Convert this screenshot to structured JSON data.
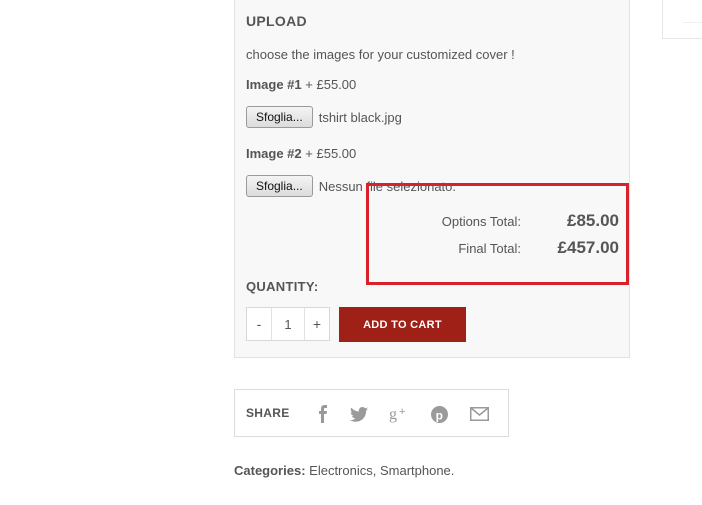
{
  "upload": {
    "title": "UPLOAD",
    "description": "choose the images for your customized cover !",
    "images": [
      {
        "label": "Image #1",
        "price": "+ £55.00",
        "button": "Sfoglia...",
        "file": "tshirt black.jpg"
      },
      {
        "label": "Image #2",
        "price": "+ £55.00",
        "button": "Sfoglia...",
        "file": "Nessun file selezionato."
      }
    ]
  },
  "totals": {
    "options_label": "Options Total:",
    "options_value": "£85.00",
    "final_label": "Final Total:",
    "final_value": "£457.00"
  },
  "quantity": {
    "label": "QUANTITY:",
    "minus": "-",
    "value": "1",
    "plus": "+",
    "add_to_cart": "ADD TO CART"
  },
  "share": {
    "label": "SHARE",
    "icons": [
      "facebook-icon",
      "twitter-icon",
      "google-plus-icon",
      "pinterest-icon",
      "email-icon"
    ]
  },
  "categories": {
    "label": "Categories:",
    "value": "Electronics, Smartphone."
  },
  "colors": {
    "cart_button": "#9e2016",
    "highlight": "#d8212b",
    "icon": "#9a9a9a"
  }
}
